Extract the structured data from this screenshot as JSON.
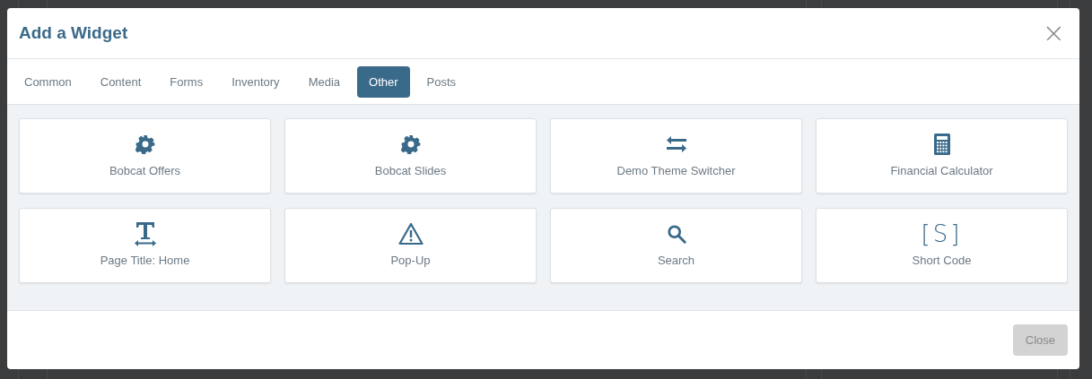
{
  "dialog": {
    "title": "Add a Widget",
    "close_icon": "×"
  },
  "tabs": [
    {
      "label": "Common",
      "selected": false
    },
    {
      "label": "Content",
      "selected": false
    },
    {
      "label": "Forms",
      "selected": false
    },
    {
      "label": "Inventory",
      "selected": false
    },
    {
      "label": "Media",
      "selected": false
    },
    {
      "label": "Other",
      "selected": true
    },
    {
      "label": "Posts",
      "selected": false
    }
  ],
  "widgets": [
    {
      "label": "Bobcat Offers"
    },
    {
      "label": "Bobcat Slides"
    },
    {
      "label": "Demo Theme Switcher"
    },
    {
      "label": "Financial Calculator"
    },
    {
      "label": "Page Title: Home"
    },
    {
      "label": "Pop-Up"
    },
    {
      "label": "Search"
    },
    {
      "label": "Short Code",
      "glyph": "[S]"
    }
  ],
  "footer": {
    "button": {
      "label": "Close",
      "disabled": true
    }
  }
}
